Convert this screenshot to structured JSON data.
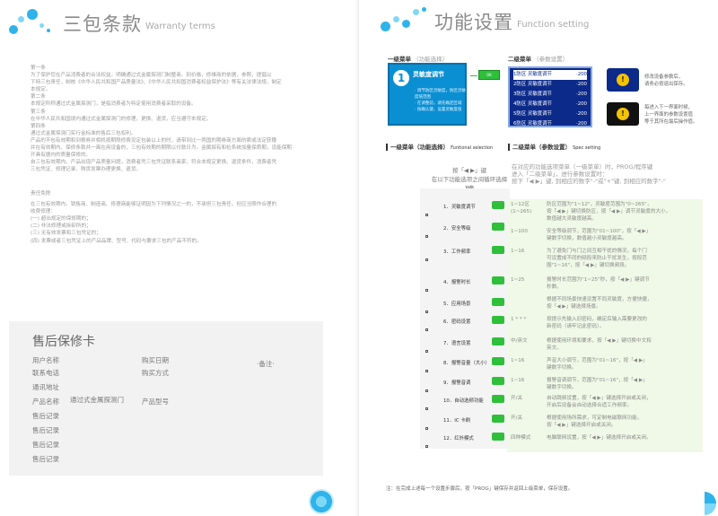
{
  "left": {
    "header": {
      "title": "三包条款",
      "subtitle": "Warranty terms"
    },
    "lines_a": [
      "第一条",
      "  为了保护您在产品消费者的合法权益，明确通过式金属探测门制整商、别价格，修维商的依据，参照，提倡以",
      "下特三包责任，制核《中华人民共和国产品质量法》、《中华人民共和国消费者权益保护法》等有关法律法规，制定",
      "本规定。",
      "第二条",
      "  本规定所称通过式金属探测门，是指消费者为特定使用消费者采取的设备。",
      "第三条",
      "  在中华人民共和国境内通过式金属探测门的修理、更换、退货，应当遵守本规定。",
      "第四条",
      "  通过式金属探测门实行金标准的售后三包权利。",
      "  产品的不包有效期和到根券并相机按期限修费设定包装以上的时，请带到比一两国的期券商方面的索或法定获赠",
      "并在有效期内、保修条款并一离在用设备的，三包有效期的期限以付款日为。金属探有和检系统加量保质期，设能保期",
      "开具有据内的质量保修的。",
      "  自三包有效期内，产品出现产品质量问题，消费者凭三包凭证联系商家，符合本规定更换、退货条件，消费者凭",
      "三包凭证、修理记录、购货发票办理更换、退货。"
    ],
    "lines_b": [
      "责任免除",
      "  在三包有效期内，销售商、制造商、修理商能够证明因为下列情况之一的，不承担三包责任。但应当照作合理的",
      "收费修理：",
      "  (一) 超出规定的保修期的；",
      "  (二) 非法修理或拆卸所的；",
      "  (三) 无有效发票和三包凭证的；",
      "  (四) 发票或者三包凭证上的产品品牌、型号、代码与要求三包的产品不符的。"
    ],
    "card": {
      "title": "售后保修卡",
      "labels": [
        "用户名称",
        "联系电话",
        "通讯地址",
        "产品名称",
        "售后记录",
        "售后记录",
        "售后记录",
        "售后记录"
      ],
      "product_value": "通过式金属探测门",
      "labels2": [
        "购买日期",
        "购买方式",
        "产品型号"
      ],
      "remark": "·备注·"
    }
  },
  "right": {
    "header": {
      "title": "功能设置",
      "subtitle": "Function setting"
    },
    "menu1_label": "一级菜单",
    "menu1_hint": "（功能选择）",
    "menu2_label": "二级菜单",
    "menu2_hint": "（参数设置）",
    "bluebox": {
      "num": "1",
      "title": "灵敏度调节",
      "desc": [
        "· 调节防区灵敏度，防区灵敏",
        "  度值范围",
        "· 在调整前，请先确定区域",
        "· 按确认键，设置灵敏度值"
      ]
    },
    "green_label": "OK",
    "screen_rows": [
      {
        "a": "1防区  灵敏度调节",
        "b": "·200"
      },
      {
        "a": "2防区  灵敏度调节",
        "b": "·200"
      },
      {
        "a": "3防区  灵敏度调节",
        "b": "·200"
      },
      {
        "a": "4防区  灵敏度调节",
        "b": "·200"
      },
      {
        "a": "5防区  灵敏度调节",
        "b": "·200"
      },
      {
        "a": "6防区  灵敏度调节",
        "b": "·200"
      }
    ],
    "notes": [
      [
        "修改设备参数后，",
        "请务必按退出保存。"
      ],
      [
        "每进入下一界面时候，",
        "上一界面的参数设置值",
        "等于其所在最后操作值。"
      ]
    ],
    "sect1": "一级菜单（功能选择）",
    "sect1_en": "Funtional selection",
    "sect2": "二级菜单（参数设置）",
    "sect2_en": "Spec setting",
    "instr1": [
      "按「◀ ▶」键",
      "在以下功能选项之间循环选择"
    ],
    "instr2": [
      "在对应的功能选项菜单（一级菜单）时，PROG/程序键",
      "进入「二级菜单」，进行参数设置时：",
      "按下「◀ ▶」键, 到相应的数字\"-\"或\"+\"键, 到相应的数字\"-\""
    ],
    "col_head": "功能",
    "items": [
      "1．灵敏度调节",
      "2．安全等级",
      "3．工作频率",
      "4．报警时长",
      "5．应用场景",
      "6．密码设置",
      "7．语言设置",
      "8．报警音量（大小）",
      "9．报警音调",
      "10．自动选频功能",
      "11．IC 卡刷",
      "12．红外模式"
    ],
    "ranges": [
      "1~12区\n(1~265)",
      "1~100",
      "1~16",
      "1~25",
      "",
      "1 * * *",
      "中/英文",
      "1~16",
      "1~16",
      "开/关",
      "开/关",
      "四种模式"
    ],
    "descs": [
      [
        "防区范围为\"1~12\"，灵敏度范围为\"0~265\"，",
        "按「◀ ▶」键切换防区，按「◀ ▶」调节灵敏度的大小，",
        "数值越大灵敏度越高。"
      ],
      [
        "安全等级调节，范围为\"01~100\"，按「◀ ▶」",
        "键数字切换，数值越小灵敏度越高。"
      ],
      [
        "为了避免门与门之间互相干扰的情况，每个门",
        "可设置成不同的频段来防止干扰发生，按段范",
        "围\"1~16\"，按「◀ ▶」键切换频段。"
      ],
      [
        "报警时长范围为\"1~25\"秒，按「◀ ▶」键调节",
        "秒数。"
      ],
      [
        "根据不同场景快速设置不同灵敏度，方便快捷，",
        "按「◀ ▶」键选择场景。"
      ],
      [
        "按提示先输入旧密码，确定后输入需要更改的",
        "新密码（请牢记此密码）。"
      ],
      [
        "根据使用环境和要求，按「◀ ▶」键切换中文和",
        "英文。"
      ],
      [
        "声音大小调节，范围为\"01~16\"，按「◀ ▶」",
        "键数字切换。"
      ],
      [
        "报警音调调节，范围为\"01~16\"，按「◀ ▶」",
        "键数字切换。"
      ],
      [
        "自动跳频设置，按「◀ ▶」键选择开启或关闭，",
        "开启后设备会自动选择合适工作频率。"
      ],
      [
        "根据使用场所需求，可定制电磁联网功能，",
        "按「◀ ▶」键选择开启或关闭。"
      ],
      [
        "电脑联网设置，按「◀ ▶」键选择开启或关闭。"
      ]
    ],
    "footnote": "注：在完成上述每一个设置步骤后，按「PROG」键保存并返回上级菜单，保存设置。"
  }
}
